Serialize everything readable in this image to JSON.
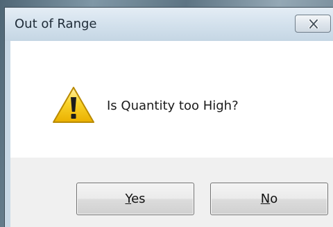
{
  "dialog": {
    "title": "Out of Range",
    "message": "Is Quantity too High?",
    "icon": "warning-icon"
  },
  "buttons": {
    "yes": {
      "accel": "Y",
      "rest": "es"
    },
    "no": {
      "accel": "N",
      "rest": "o"
    }
  },
  "colors": {
    "warning_fill": "#f5c400",
    "titlebar": "#d2e0ec",
    "content_bg": "#ffffff",
    "footer_bg": "#f0f0f0"
  }
}
